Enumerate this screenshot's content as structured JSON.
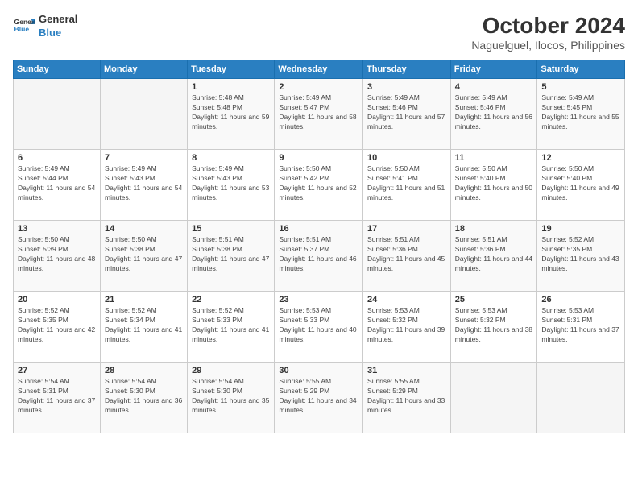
{
  "logo": {
    "line1": "General",
    "line2": "Blue"
  },
  "title": "October 2024",
  "location": "Naguelguel, Ilocos, Philippines",
  "weekdays": [
    "Sunday",
    "Monday",
    "Tuesday",
    "Wednesday",
    "Thursday",
    "Friday",
    "Saturday"
  ],
  "weeks": [
    [
      {
        "day": "",
        "sunrise": "",
        "sunset": "",
        "daylight": ""
      },
      {
        "day": "",
        "sunrise": "",
        "sunset": "",
        "daylight": ""
      },
      {
        "day": "1",
        "sunrise": "Sunrise: 5:48 AM",
        "sunset": "Sunset: 5:48 PM",
        "daylight": "Daylight: 11 hours and 59 minutes."
      },
      {
        "day": "2",
        "sunrise": "Sunrise: 5:49 AM",
        "sunset": "Sunset: 5:47 PM",
        "daylight": "Daylight: 11 hours and 58 minutes."
      },
      {
        "day": "3",
        "sunrise": "Sunrise: 5:49 AM",
        "sunset": "Sunset: 5:46 PM",
        "daylight": "Daylight: 11 hours and 57 minutes."
      },
      {
        "day": "4",
        "sunrise": "Sunrise: 5:49 AM",
        "sunset": "Sunset: 5:46 PM",
        "daylight": "Daylight: 11 hours and 56 minutes."
      },
      {
        "day": "5",
        "sunrise": "Sunrise: 5:49 AM",
        "sunset": "Sunset: 5:45 PM",
        "daylight": "Daylight: 11 hours and 55 minutes."
      }
    ],
    [
      {
        "day": "6",
        "sunrise": "Sunrise: 5:49 AM",
        "sunset": "Sunset: 5:44 PM",
        "daylight": "Daylight: 11 hours and 54 minutes."
      },
      {
        "day": "7",
        "sunrise": "Sunrise: 5:49 AM",
        "sunset": "Sunset: 5:43 PM",
        "daylight": "Daylight: 11 hours and 54 minutes."
      },
      {
        "day": "8",
        "sunrise": "Sunrise: 5:49 AM",
        "sunset": "Sunset: 5:43 PM",
        "daylight": "Daylight: 11 hours and 53 minutes."
      },
      {
        "day": "9",
        "sunrise": "Sunrise: 5:50 AM",
        "sunset": "Sunset: 5:42 PM",
        "daylight": "Daylight: 11 hours and 52 minutes."
      },
      {
        "day": "10",
        "sunrise": "Sunrise: 5:50 AM",
        "sunset": "Sunset: 5:41 PM",
        "daylight": "Daylight: 11 hours and 51 minutes."
      },
      {
        "day": "11",
        "sunrise": "Sunrise: 5:50 AM",
        "sunset": "Sunset: 5:40 PM",
        "daylight": "Daylight: 11 hours and 50 minutes."
      },
      {
        "day": "12",
        "sunrise": "Sunrise: 5:50 AM",
        "sunset": "Sunset: 5:40 PM",
        "daylight": "Daylight: 11 hours and 49 minutes."
      }
    ],
    [
      {
        "day": "13",
        "sunrise": "Sunrise: 5:50 AM",
        "sunset": "Sunset: 5:39 PM",
        "daylight": "Daylight: 11 hours and 48 minutes."
      },
      {
        "day": "14",
        "sunrise": "Sunrise: 5:50 AM",
        "sunset": "Sunset: 5:38 PM",
        "daylight": "Daylight: 11 hours and 47 minutes."
      },
      {
        "day": "15",
        "sunrise": "Sunrise: 5:51 AM",
        "sunset": "Sunset: 5:38 PM",
        "daylight": "Daylight: 11 hours and 47 minutes."
      },
      {
        "day": "16",
        "sunrise": "Sunrise: 5:51 AM",
        "sunset": "Sunset: 5:37 PM",
        "daylight": "Daylight: 11 hours and 46 minutes."
      },
      {
        "day": "17",
        "sunrise": "Sunrise: 5:51 AM",
        "sunset": "Sunset: 5:36 PM",
        "daylight": "Daylight: 11 hours and 45 minutes."
      },
      {
        "day": "18",
        "sunrise": "Sunrise: 5:51 AM",
        "sunset": "Sunset: 5:36 PM",
        "daylight": "Daylight: 11 hours and 44 minutes."
      },
      {
        "day": "19",
        "sunrise": "Sunrise: 5:52 AM",
        "sunset": "Sunset: 5:35 PM",
        "daylight": "Daylight: 11 hours and 43 minutes."
      }
    ],
    [
      {
        "day": "20",
        "sunrise": "Sunrise: 5:52 AM",
        "sunset": "Sunset: 5:35 PM",
        "daylight": "Daylight: 11 hours and 42 minutes."
      },
      {
        "day": "21",
        "sunrise": "Sunrise: 5:52 AM",
        "sunset": "Sunset: 5:34 PM",
        "daylight": "Daylight: 11 hours and 41 minutes."
      },
      {
        "day": "22",
        "sunrise": "Sunrise: 5:52 AM",
        "sunset": "Sunset: 5:33 PM",
        "daylight": "Daylight: 11 hours and 41 minutes."
      },
      {
        "day": "23",
        "sunrise": "Sunrise: 5:53 AM",
        "sunset": "Sunset: 5:33 PM",
        "daylight": "Daylight: 11 hours and 40 minutes."
      },
      {
        "day": "24",
        "sunrise": "Sunrise: 5:53 AM",
        "sunset": "Sunset: 5:32 PM",
        "daylight": "Daylight: 11 hours and 39 minutes."
      },
      {
        "day": "25",
        "sunrise": "Sunrise: 5:53 AM",
        "sunset": "Sunset: 5:32 PM",
        "daylight": "Daylight: 11 hours and 38 minutes."
      },
      {
        "day": "26",
        "sunrise": "Sunrise: 5:53 AM",
        "sunset": "Sunset: 5:31 PM",
        "daylight": "Daylight: 11 hours and 37 minutes."
      }
    ],
    [
      {
        "day": "27",
        "sunrise": "Sunrise: 5:54 AM",
        "sunset": "Sunset: 5:31 PM",
        "daylight": "Daylight: 11 hours and 37 minutes."
      },
      {
        "day": "28",
        "sunrise": "Sunrise: 5:54 AM",
        "sunset": "Sunset: 5:30 PM",
        "daylight": "Daylight: 11 hours and 36 minutes."
      },
      {
        "day": "29",
        "sunrise": "Sunrise: 5:54 AM",
        "sunset": "Sunset: 5:30 PM",
        "daylight": "Daylight: 11 hours and 35 minutes."
      },
      {
        "day": "30",
        "sunrise": "Sunrise: 5:55 AM",
        "sunset": "Sunset: 5:29 PM",
        "daylight": "Daylight: 11 hours and 34 minutes."
      },
      {
        "day": "31",
        "sunrise": "Sunrise: 5:55 AM",
        "sunset": "Sunset: 5:29 PM",
        "daylight": "Daylight: 11 hours and 33 minutes."
      },
      {
        "day": "",
        "sunrise": "",
        "sunset": "",
        "daylight": ""
      },
      {
        "day": "",
        "sunrise": "",
        "sunset": "",
        "daylight": ""
      }
    ]
  ]
}
